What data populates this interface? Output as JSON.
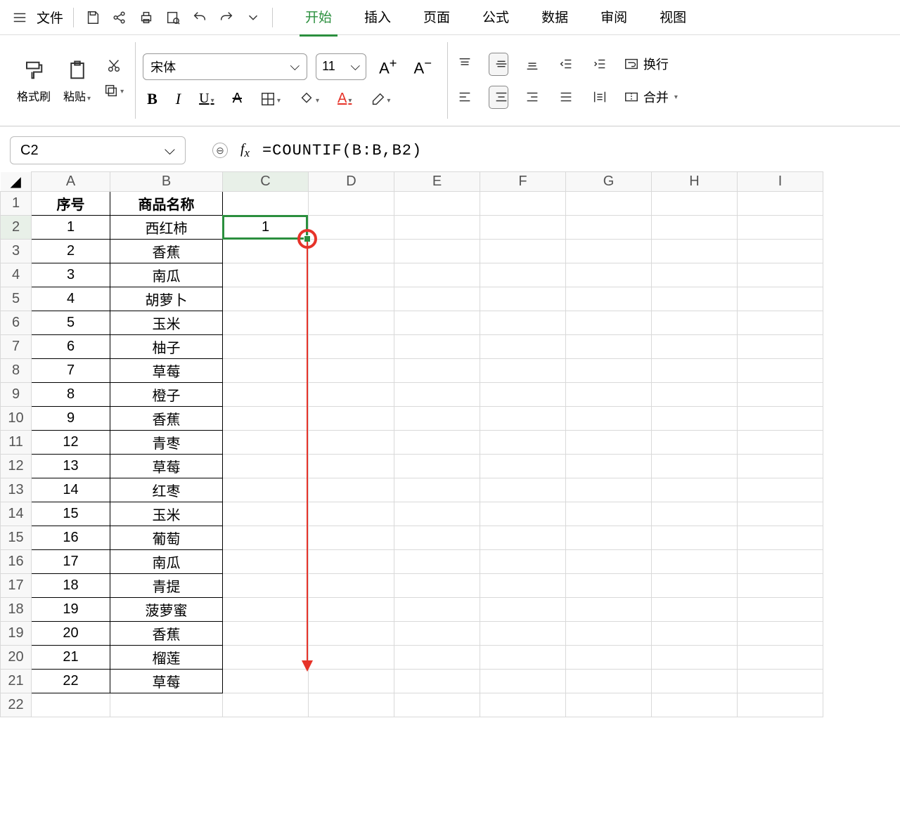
{
  "menu": {
    "file": "文件",
    "tabs": [
      "开始",
      "插入",
      "页面",
      "公式",
      "数据",
      "审阅",
      "视图"
    ],
    "active_tab": 0
  },
  "ribbon": {
    "format_painter": "格式刷",
    "paste": "粘贴",
    "font_name": "宋体",
    "font_size": "11",
    "wrap_text": "换行",
    "merge": "合并"
  },
  "namebox": "C2",
  "formula": "=COUNTIF(B:B,B2)",
  "columns": [
    "A",
    "B",
    "C",
    "D",
    "E",
    "F",
    "G",
    "H",
    "I"
  ],
  "headers": {
    "A": "序号",
    "B": "商品名称"
  },
  "selected_cell_value": "1",
  "rows": [
    {
      "n": "1",
      "name": "西红柿"
    },
    {
      "n": "2",
      "name": "香蕉"
    },
    {
      "n": "3",
      "name": "南瓜"
    },
    {
      "n": "4",
      "name": "胡萝卜"
    },
    {
      "n": "5",
      "name": "玉米"
    },
    {
      "n": "6",
      "name": "柚子"
    },
    {
      "n": "7",
      "name": "草莓"
    },
    {
      "n": "8",
      "name": "橙子"
    },
    {
      "n": "9",
      "name": "香蕉"
    },
    {
      "n": "12",
      "name": "青枣"
    },
    {
      "n": "13",
      "name": "草莓"
    },
    {
      "n": "14",
      "name": "红枣"
    },
    {
      "n": "15",
      "name": "玉米"
    },
    {
      "n": "16",
      "name": "葡萄"
    },
    {
      "n": "17",
      "name": "南瓜"
    },
    {
      "n": "18",
      "name": "青提"
    },
    {
      "n": "19",
      "name": "菠萝蜜"
    },
    {
      "n": "20",
      "name": "香蕉"
    },
    {
      "n": "21",
      "name": "榴莲"
    },
    {
      "n": "22",
      "name": "草莓"
    }
  ]
}
